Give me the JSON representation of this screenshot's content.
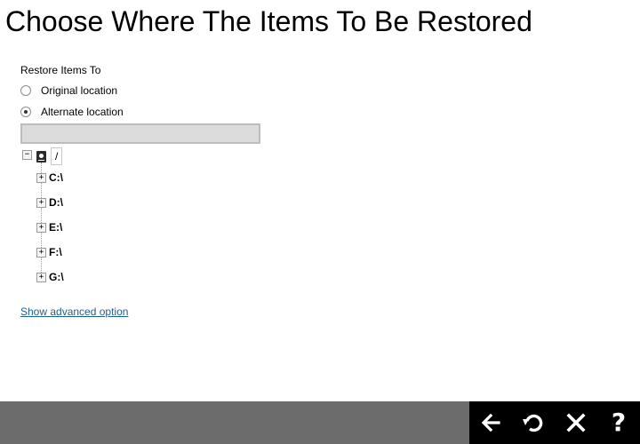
{
  "page": {
    "title": "Choose Where The Items To Be Restored"
  },
  "restore": {
    "section_label": "Restore Items To",
    "options": [
      {
        "label": "Original location",
        "selected": false
      },
      {
        "label": "Alternate location",
        "selected": true
      }
    ],
    "path_value": ""
  },
  "tree": {
    "root": {
      "label": "/",
      "expanded": true,
      "icon": "computer-icon",
      "toggle_symbol": "−"
    },
    "drives": [
      {
        "label": "C:\\",
        "toggle_symbol": "+"
      },
      {
        "label": "D:\\",
        "toggle_symbol": "+"
      },
      {
        "label": "E:\\",
        "toggle_symbol": "+"
      },
      {
        "label": "F:\\",
        "toggle_symbol": "+"
      },
      {
        "label": "G:\\",
        "toggle_symbol": "+"
      }
    ]
  },
  "links": {
    "advanced": "Show advanced option"
  },
  "footer": {
    "buttons": [
      {
        "name": "back",
        "icon": "arrow-left-icon"
      },
      {
        "name": "restart",
        "icon": "undo-icon"
      },
      {
        "name": "close",
        "icon": "close-icon"
      },
      {
        "name": "help",
        "icon": "question-icon",
        "glyph": "?"
      }
    ]
  },
  "colors": {
    "footer_bar": "#6c6c6c",
    "button_bar": "#000000",
    "link": "#1f5f8b",
    "input_bg": "#dcdcdc"
  }
}
